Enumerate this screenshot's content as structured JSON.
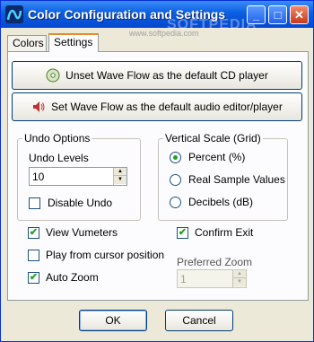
{
  "window": {
    "title": "Color Configuration and Settings",
    "watermark": "SOFTPEDIA",
    "watermark_url": "www.softpedia.com",
    "controls": {
      "minimize": "_",
      "maximize": "□",
      "close": "✕"
    },
    "colors": {
      "titlebar": "#0a5fe0",
      "face": "#ece9d8",
      "check": "#21a121"
    }
  },
  "tabs": [
    {
      "label": "Colors",
      "active": false
    },
    {
      "label": "Settings",
      "active": true
    }
  ],
  "settings": {
    "unset_cd_label": "Unset Wave Flow as the default CD player",
    "set_editor_label": "Set Wave Flow as the default audio editor/player",
    "undo": {
      "group_title": "Undo Options",
      "levels_label": "Undo Levels",
      "levels_value": "10",
      "disable_label": "Disable Undo",
      "disable_checked": false
    },
    "vertical_scale": {
      "group_title": "Vertical Scale (Grid)",
      "options": [
        {
          "label": "Percent (%)",
          "selected": true
        },
        {
          "label": "Real Sample Values",
          "selected": false
        },
        {
          "label": "Decibels (dB)",
          "selected": false
        }
      ]
    },
    "view_vumeters": {
      "label": "View Vumeters",
      "checked": true
    },
    "confirm_exit": {
      "label": "Confirm Exit",
      "checked": true
    },
    "play_from_cursor": {
      "label": "Play from cursor position",
      "checked": false
    },
    "auto_zoom": {
      "label": "Auto Zoom",
      "checked": true
    },
    "preferred_zoom": {
      "label": "Preferred Zoom",
      "value": "1",
      "disabled": true
    }
  },
  "footer": {
    "ok_label": "OK",
    "cancel_label": "Cancel"
  }
}
